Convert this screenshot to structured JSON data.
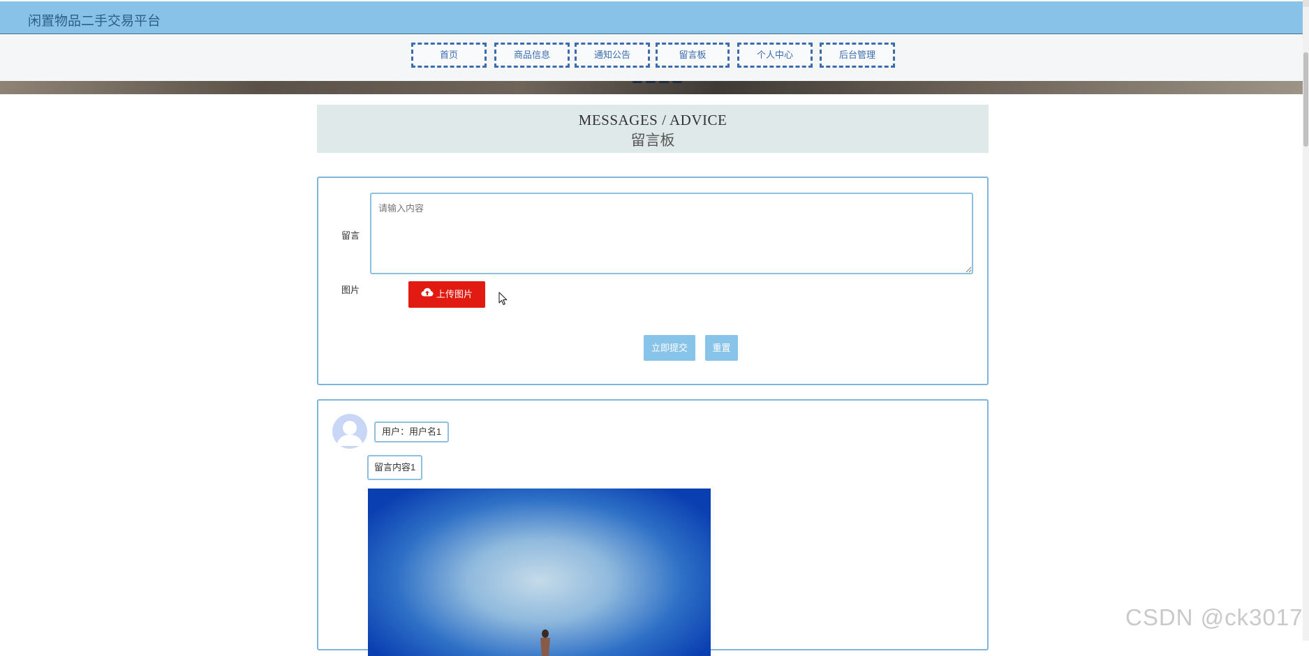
{
  "header": {
    "site_title": "闲置物品二手交易平台"
  },
  "nav": {
    "items": [
      {
        "label": "首页"
      },
      {
        "label": "商品信息"
      },
      {
        "label": "通知公告"
      },
      {
        "label": "留言板"
      },
      {
        "label": "个人中心"
      },
      {
        "label": "后台管理"
      }
    ]
  },
  "page_heading": {
    "en": "MESSAGES / ADVICE",
    "cn": "留言板"
  },
  "form": {
    "message_label": "留言",
    "message_placeholder": "请输入内容",
    "image_label": "图片",
    "upload_label": "上传图片",
    "submit_label": "立即提交",
    "reset_label": "重置"
  },
  "messages": [
    {
      "user": "用户：用户名1",
      "content": "留言内容1"
    }
  ],
  "watermark": "CSDN @ck3017",
  "colors": {
    "header_bg": "#89c2e8",
    "nav_border": "#3a6cb0",
    "upload_button": "#e21b12",
    "action_button": "#88c4ea",
    "panel_border": "#7fb5d8"
  }
}
